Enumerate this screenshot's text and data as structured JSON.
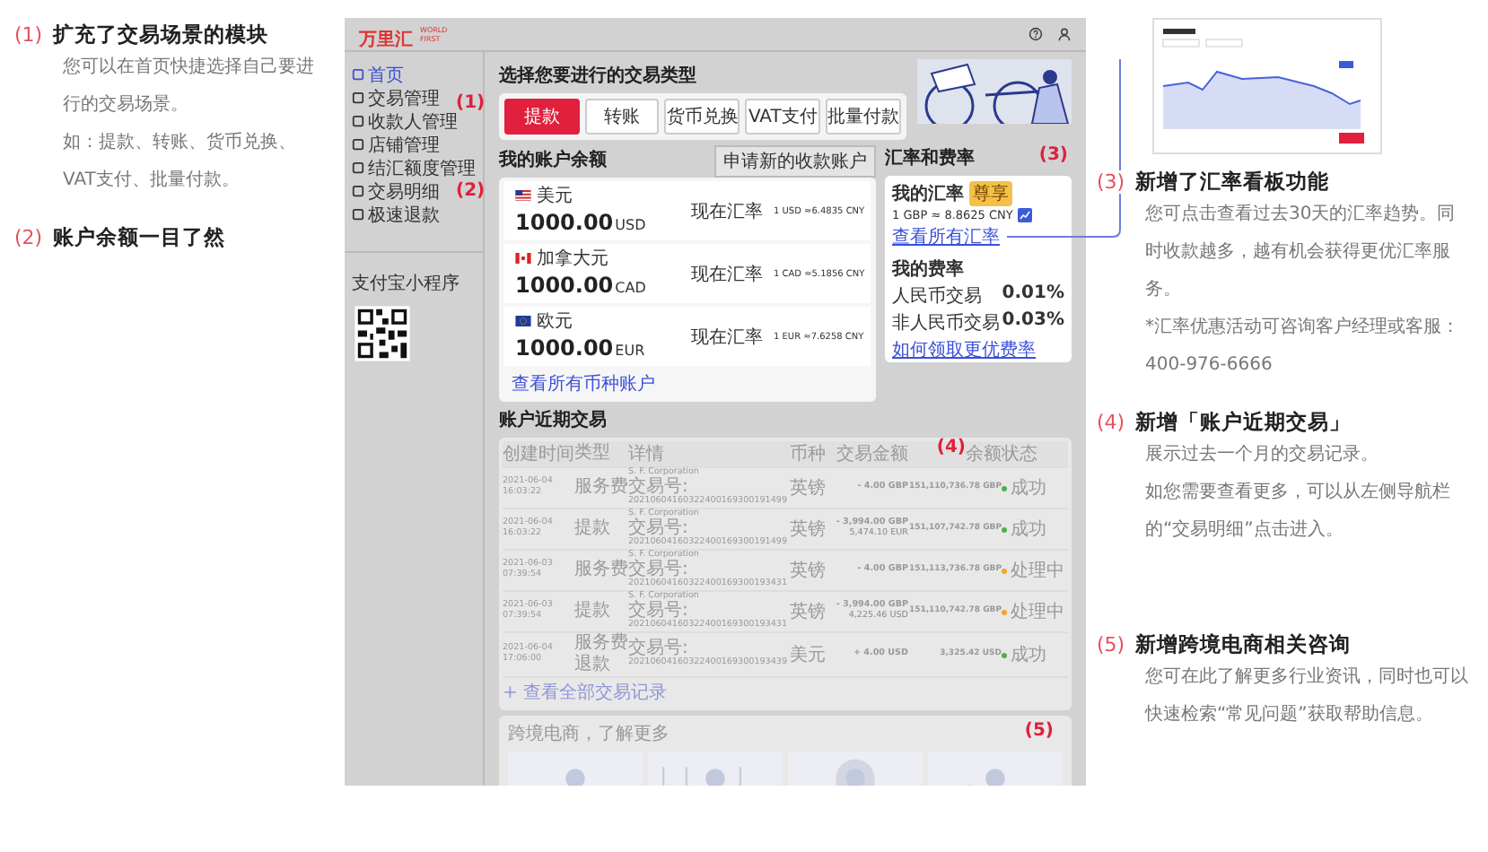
{
  "left_notes": [
    {
      "number": "(1)",
      "title": "扩充了交易场景的模块",
      "paragraphs": [
        "您可以在首页快捷选择自己要进行的交易场景。",
        "如：提款、转账、货币兑换、VAT支付、批量付款。"
      ]
    },
    {
      "number": "(2)",
      "title": "账户余额一目了然"
    }
  ],
  "screen": {
    "logo": {
      "mark": "万里汇",
      "sub": "WORLD FIRST"
    },
    "sidebar": {
      "items": [
        {
          "label": "首页",
          "selected": true
        },
        {
          "label": "交易管理",
          "selected": false
        },
        {
          "label": "收款人管理",
          "selected": false
        },
        {
          "label": "店铺管理",
          "selected": false
        },
        {
          "label": "结汇额度管理",
          "selected": false
        },
        {
          "label": "交易明细",
          "selected": false
        },
        {
          "label": "极速退款",
          "selected": false
        }
      ],
      "mini_program": "支付宝小程序"
    },
    "trade": {
      "title": "选择您要进行的交易类型",
      "marker": "(1)",
      "buttons": [
        {
          "label": "提款",
          "selected": true
        },
        {
          "label": "转账",
          "selected": false
        },
        {
          "label": "货币兑换",
          "selected": false
        },
        {
          "label": "VAT支付",
          "selected": false
        },
        {
          "label": "批量付款",
          "selected": false
        }
      ]
    },
    "balances": {
      "title": "我的账户余额",
      "marker": "(2)",
      "apply_button": "申请新的收款账户",
      "accounts": [
        {
          "kind": "us",
          "currency": "美元",
          "amount": "1000.00",
          "code": "USD",
          "rate_label": "现在汇率",
          "rate": "1 USD ≈6.4835 CNY"
        },
        {
          "kind": "ca",
          "currency": "加拿大元",
          "amount": "1000.00",
          "code": "CAD",
          "rate_label": "现在汇率",
          "rate": "1 CAD ≈5.1856 CNY"
        },
        {
          "kind": "eu",
          "currency": "欧元",
          "amount": "1000.00",
          "code": "EUR",
          "rate_label": "现在汇率",
          "rate": "1 EUR ≈7.6258 CNY"
        }
      ],
      "more_link": "查看所有币种账户"
    },
    "rates": {
      "title": "汇率和费率",
      "marker": "(3)",
      "my_rate": "我的汇率",
      "badge": "尊享",
      "quote": "1 GBP ≈ 8.8625 CNY",
      "all_rates_link": "查看所有汇率",
      "fees_label": "我的费率",
      "fees": [
        {
          "name": "人民币交易",
          "value": "0.01%"
        },
        {
          "name": "非人民币交易",
          "value": "0.03%"
        }
      ],
      "fee_link": "如何领取更优费率"
    },
    "transactions": {
      "title": "账户近期交易",
      "marker": "(4)",
      "columns": [
        "创建时间",
        "类型",
        "详情",
        "币种",
        "交易金额",
        "余额",
        "状态"
      ],
      "rows": [
        {
          "date": "2021-06-04",
          "time": "16:03:22",
          "type": "服务费",
          "company": "S. F. Corporation",
          "ref_label": "交易号:",
          "ref": "20210604160322400169300191499",
          "currency": "英镑",
          "amount": "- 4.00 GBP",
          "balance": "151,110,736.78 GBP",
          "status": "成功",
          "color": "#4caf50"
        },
        {
          "date": "2021-06-04",
          "time": "16:03:22",
          "type": "提款",
          "company": "S. F. Corporation",
          "ref_label": "交易号:",
          "ref": "20210604160322400169300191499",
          "currency": "英镑",
          "amount": "- 3,994.00 GBP",
          "amount_sub": "5,474.10 EUR",
          "balance": "151,107,742.78 GBP",
          "status": "成功",
          "color": "#4caf50"
        },
        {
          "date": "2021-06-03",
          "time": "07:39:54",
          "type": "服务费",
          "company": "S. F. Corporation",
          "ref_label": "交易号:",
          "ref": "20210604160322400169300193431",
          "currency": "英镑",
          "amount": "- 4.00 GBP",
          "balance": "151,113,736.78 GBP",
          "status": "处理中",
          "color": "#f5a623"
        },
        {
          "date": "2021-06-03",
          "time": "07:39:54",
          "type": "提款",
          "company": "S. F. Corporation",
          "ref_label": "交易号:",
          "ref": "20210604160322400169300193431",
          "currency": "英镑",
          "amount": "- 3,994.00 GBP",
          "amount_sub": "4,225.46 USD",
          "balance": "151,110,742.78 GBP",
          "status": "处理中",
          "color": "#f5a623"
        },
        {
          "date": "2021-06-04",
          "time": "17:06:00",
          "type": "服务费退款",
          "ref_label": "交易号:",
          "ref": "20210604160322400169300193439",
          "currency": "美元",
          "amount": "+ 4.00 USD",
          "balance": "3,325.42 USD",
          "status": "成功",
          "color": "#4caf50"
        }
      ],
      "more_link": "+ 查看全部交易记录"
    },
    "ecommerce": {
      "title": "跨境电商，了解更多",
      "marker": "(5)"
    }
  },
  "right_notes": [
    {
      "number": "(3)",
      "title": "新增了汇率看板功能",
      "paragraphs": [
        "您可点击查看过去30天的汇率趋势。同时收款越多，越有机会获得更优汇率服务。",
        "*汇率优惠活动可咨询客户经理或客服：400-976-6666"
      ]
    },
    {
      "number": "(4)",
      "title": "新增「账户近期交易」",
      "paragraphs": [
        "展示过去一个月的交易记录。",
        "如您需要查看更多，可以从左侧导航栏的“交易明细”点击进入。"
      ]
    },
    {
      "number": "(5)",
      "title": "新增跨境电商相关咨询",
      "paragraphs": [
        "您可在此了解更多行业资讯，同时也可以快速检索“常见问题”获取帮助信息。"
      ]
    }
  ]
}
